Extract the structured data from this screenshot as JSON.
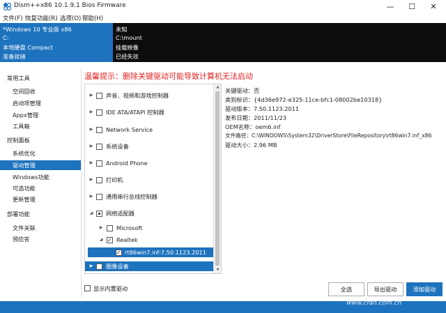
{
  "window": {
    "title": "Dism++x86 10.1.9.1 Bios Firmware"
  },
  "menu": [
    "文件(F)",
    "恢复功能(R)",
    "选项(O)",
    "帮助(H)"
  ],
  "info": {
    "left": [
      "*Windows 10 专业版 x86",
      "C:",
      "本地硬盘 Compact",
      "准备就绪"
    ],
    "right": [
      "未知",
      "C:\\mount",
      "挂载映像",
      "已经失效"
    ]
  },
  "sidebar": {
    "groups": [
      {
        "label": "常用工具",
        "items": [
          "空间回收",
          "启动项管理",
          "Appx管理",
          "工具箱"
        ]
      },
      {
        "label": "控制面板",
        "items": [
          "系统优化",
          "驱动管理",
          "Windows功能",
          "可选功能",
          "更新管理"
        ]
      },
      {
        "label": "部署功能",
        "items": [
          "文件关联",
          "预应答"
        ]
      }
    ],
    "active": "驱动管理"
  },
  "warning": "温馨提示：删除关键驱动可能导致计算机无法启动",
  "tree": [
    {
      "label": "声音、视频和游戏控制器",
      "level": 0,
      "arrow": "right",
      "check": "none"
    },
    {
      "label": "IDE ATA/ATAPI 控制器",
      "level": 0,
      "arrow": "right",
      "check": "none"
    },
    {
      "label": "Network Service",
      "level": 0,
      "arrow": "right",
      "check": "none"
    },
    {
      "label": "系统设备",
      "level": 0,
      "arrow": "right",
      "check": "none"
    },
    {
      "label": "Android Phone",
      "level": 0,
      "arrow": "right",
      "check": "none"
    },
    {
      "label": "打印机",
      "level": 0,
      "arrow": "right",
      "check": "none"
    },
    {
      "label": "通用串行总线控制器",
      "level": 0,
      "arrow": "right",
      "check": "none"
    },
    {
      "label": "网络适配器",
      "level": 0,
      "arrow": "down",
      "check": "partial"
    },
    {
      "label": "Microsoft",
      "level": 1,
      "arrow": "right",
      "check": "none"
    },
    {
      "label": "Realtek",
      "level": 1,
      "arrow": "down",
      "check": "checked"
    },
    {
      "label": "rt86win7.inf-7.50.1123.2011",
      "level": 2,
      "arrow": "",
      "check": "checked",
      "selected": true
    },
    {
      "label": "图像设备",
      "level": 0,
      "arrow": "right",
      "check": "none",
      "highlight": true
    }
  ],
  "details": [
    "关键驱动：否",
    "类别标识：{4d36e972-e325-11ce-bfc1-08002be10318}",
    "驱动版本：7.50.1123.2011",
    "发布日期：2011/11/23",
    "OEM名称：oem6.inf",
    "文件路径：C:\\WINDOWS\\System32\\DriverStore\\FileRepository\\rt86win7.inf_x86",
    "驱动大小：2.96 MB"
  ],
  "show_builtin_label": "显示内置驱动",
  "buttons": {
    "select_all": "全选",
    "export": "导出驱动",
    "add": "添加驱动"
  },
  "watermark": "www.cfan.com.cn",
  "colors": {
    "accent": "#1e73be",
    "warning": "#e02020",
    "info_bg": "#0d0d0d"
  }
}
